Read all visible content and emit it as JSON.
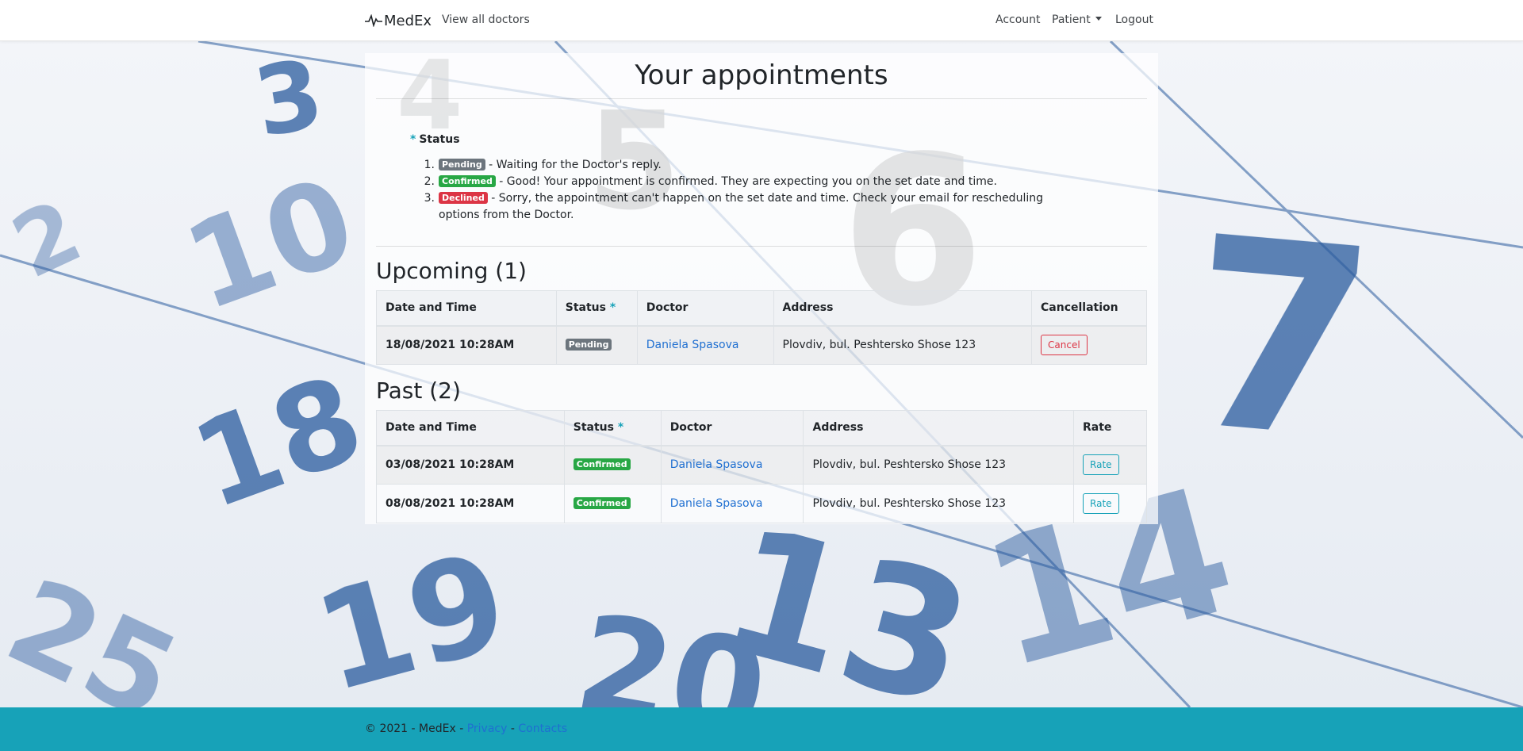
{
  "navbar": {
    "brand": "MedEx",
    "view_all_doctors": "View all doctors",
    "account": "Account",
    "patient": "Patient",
    "logout": "Logout"
  },
  "page": {
    "title": "Your appointments"
  },
  "legend": {
    "star": "*",
    "heading": "Status",
    "items": [
      {
        "num": "1.",
        "badge": "Pending",
        "text": " - Waiting for the Doctor's reply."
      },
      {
        "num": "2.",
        "badge": "Confirmed",
        "text": " - Good! Your appointment is confirmed. They are expecting you on the set date and time."
      },
      {
        "num": "3.",
        "badge": "Declined",
        "text": " - Sorry, the appointment can't happen on the set date and time. Check your email for rescheduling options from the Doctor."
      }
    ]
  },
  "upcoming": {
    "title": "Upcoming (1)",
    "columns": [
      "Date and Time",
      "Status",
      "Doctor",
      "Address",
      "Cancellation"
    ],
    "status_star": "*",
    "rows": [
      {
        "datetime": "18/08/2021 10:28AM",
        "status": "Pending",
        "doctor": "Daniela Spasova",
        "address": "Plovdiv, bul. Peshtersko Shose 123",
        "action": "Cancel"
      }
    ]
  },
  "past": {
    "title": "Past (2)",
    "columns": [
      "Date and Time",
      "Status",
      "Doctor",
      "Address",
      "Rate"
    ],
    "status_star": "*",
    "rows": [
      {
        "datetime": "03/08/2021 10:28AM",
        "status": "Confirmed",
        "doctor": "Daniela Spasova",
        "address": "Plovdiv, bul. Peshtersko Shose 123",
        "action": "Rate"
      },
      {
        "datetime": "08/08/2021 10:28AM",
        "status": "Confirmed",
        "doctor": "Daniela Spasova",
        "address": "Plovdiv, bul. Peshtersko Shose 123",
        "action": "Rate"
      }
    ]
  },
  "footer": {
    "copyright": "© 2021 - MedEx - ",
    "privacy": "Privacy",
    "separator": " - ",
    "contacts": "Contacts"
  },
  "colors": {
    "pending": "#6c757d",
    "confirmed": "#28a745",
    "declined": "#dc3545",
    "accent": "#17a2b8",
    "link": "#1f6fd1"
  },
  "background_image": "calendar-photo",
  "icons": {
    "brand": "heartbeat-icon",
    "dropdown": "caret-down-icon"
  }
}
